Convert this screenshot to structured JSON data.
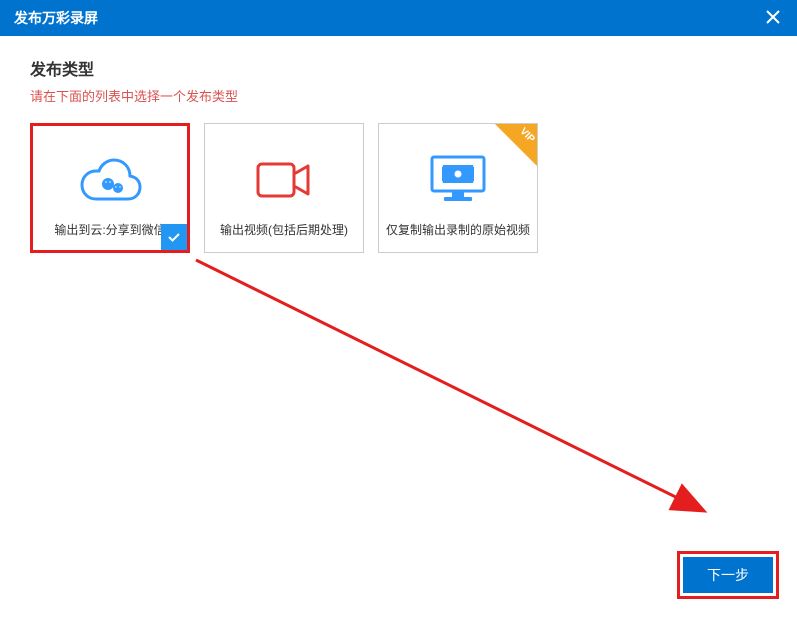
{
  "titlebar": {
    "title": "发布万彩录屏"
  },
  "section": {
    "title": "发布类型",
    "subtitle": "请在下面的列表中选择一个发布类型"
  },
  "options": [
    {
      "label": "输出到云:分享到微信",
      "selected": true,
      "vip": false
    },
    {
      "label": "输出视频(包括后期处理)",
      "selected": false,
      "vip": false
    },
    {
      "label": "仅复制输出录制的原始视频",
      "selected": false,
      "vip": true
    }
  ],
  "buttons": {
    "next": "下一步"
  },
  "vip_label": "VIP"
}
